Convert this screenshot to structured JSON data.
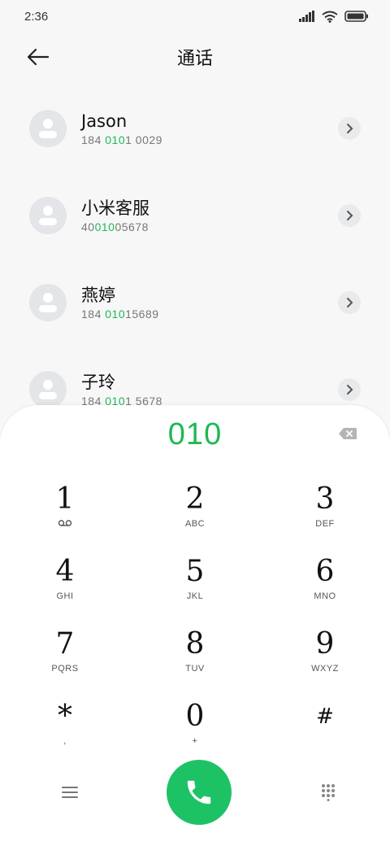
{
  "status_bar": {
    "time": "2:36"
  },
  "header": {
    "title": "通话"
  },
  "contacts": [
    {
      "name": "Jason",
      "number_pre": "184 ",
      "number_match": "010",
      "number_post": "1 0029"
    },
    {
      "name": "小米客服",
      "number_pre": "40",
      "number_match": "010",
      "number_post": "05678"
    },
    {
      "name": "燕婷",
      "number_pre": "184 ",
      "number_match": "010",
      "number_post": "15689"
    },
    {
      "name": "子玲",
      "number_pre": "184 ",
      "number_match": "010",
      "number_post": "1 5678"
    }
  ],
  "dialpad": {
    "input": "010",
    "keys": [
      {
        "digit": "1",
        "sub": ""
      },
      {
        "digit": "2",
        "sub": "ABC"
      },
      {
        "digit": "3",
        "sub": "DEF"
      },
      {
        "digit": "4",
        "sub": "GHI"
      },
      {
        "digit": "5",
        "sub": "JKL"
      },
      {
        "digit": "6",
        "sub": "MNO"
      },
      {
        "digit": "7",
        "sub": "PQRS"
      },
      {
        "digit": "8",
        "sub": "TUV"
      },
      {
        "digit": "9",
        "sub": "WXYZ"
      },
      {
        "digit": "*",
        "sub": ","
      },
      {
        "digit": "0",
        "sub": "+"
      },
      {
        "digit": "#",
        "sub": ""
      }
    ]
  },
  "colors": {
    "accent": "#1db954",
    "call_button": "#1dc265",
    "avatar_bg": "#e3e5e8"
  },
  "icons": {
    "back": "arrow-left-icon",
    "detail": "chevron-right-icon",
    "backspace": "backspace-icon",
    "voicemail": "voicemail-icon",
    "menu": "menu-icon",
    "call": "phone-icon",
    "keypad": "dialpad-icon"
  }
}
